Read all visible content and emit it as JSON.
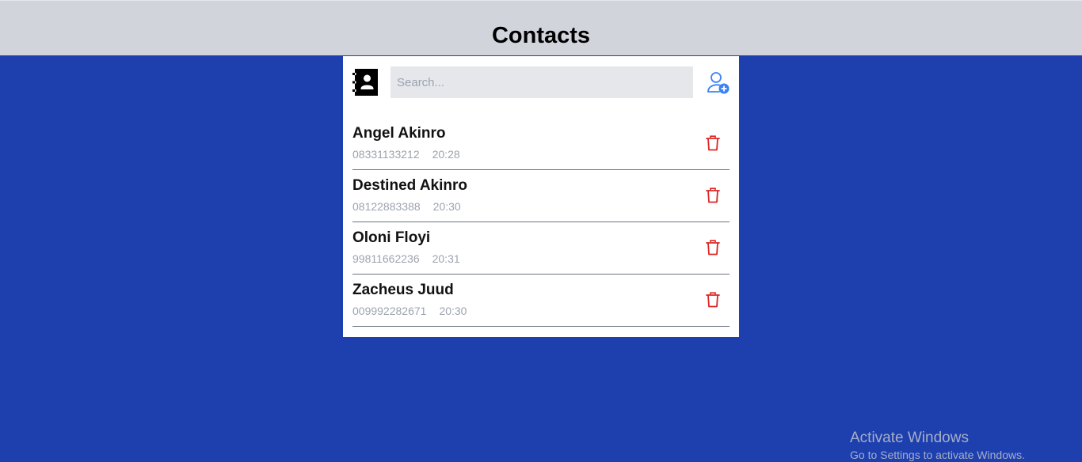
{
  "header": {
    "title": "Contacts"
  },
  "search": {
    "placeholder": "Search...",
    "value": ""
  },
  "icons": {
    "addressbook": "address-book-icon",
    "add": "add-contact-icon",
    "delete": "trash-icon"
  },
  "colors": {
    "background": "#1e40af",
    "header": "#d1d5db",
    "accent": "#3b82f6",
    "delete": "#dc2626"
  },
  "contacts": [
    {
      "name": "Angel Akinro",
      "phone": "08331133212",
      "time": "20:28"
    },
    {
      "name": "Destined Akinro",
      "phone": "08122883388",
      "time": "20:30"
    },
    {
      "name": "Oloni Floyi",
      "phone": "99811662236",
      "time": "20:31"
    },
    {
      "name": "Zacheus Juud",
      "phone": "009992282671",
      "time": "20:30"
    }
  ],
  "watermark": {
    "title": "Activate Windows",
    "subtitle": "Go to Settings to activate Windows."
  }
}
